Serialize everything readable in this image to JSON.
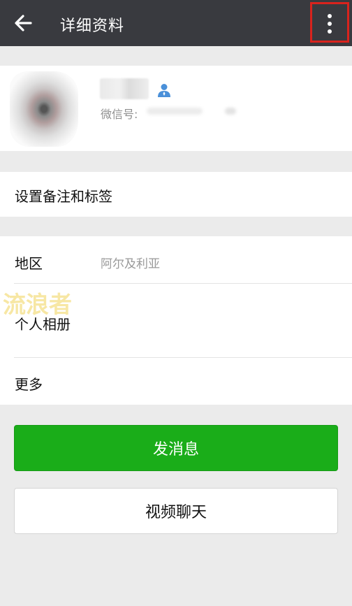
{
  "header": {
    "title": "详细资料",
    "back_icon": "arrow-left-icon",
    "more_icon": "more-vertical-icon"
  },
  "profile": {
    "wechat_id_label": "微信号:",
    "contact_icon": "person-icon"
  },
  "cells": {
    "remark_tags": "设置备注和标签",
    "region_label": "地区",
    "region_value": "阿尔及利亚",
    "album": "个人相册",
    "more": "更多"
  },
  "watermark": "流浪者",
  "buttons": {
    "send_message": "发消息",
    "video_chat": "视频聊天"
  },
  "colors": {
    "topbar": "#393a3f",
    "primary_green": "#1aad19",
    "highlight_red": "#d9231d"
  }
}
